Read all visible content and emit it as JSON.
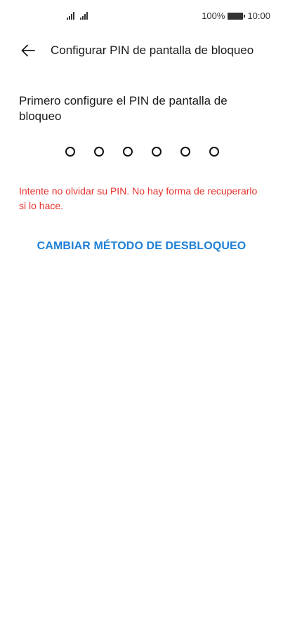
{
  "status_bar": {
    "battery_percent": "100%",
    "time": "10:00",
    "battery_level": 1.0
  },
  "header": {
    "title": "Configurar PIN de pantalla de bloqueo",
    "back_icon": "arrow-left-icon"
  },
  "main": {
    "instruction": "Primero configure el PIN de pantalla de bloqueo",
    "pin_length": 6,
    "warning": "Intente no olvidar su PIN. No hay forma de recuperarlo si lo hace.",
    "change_method_label": "CAMBIAR MÉTODO DE DESBLOQUEO"
  },
  "colors": {
    "warning": "#e5312c",
    "link": "#1e7fd6"
  }
}
